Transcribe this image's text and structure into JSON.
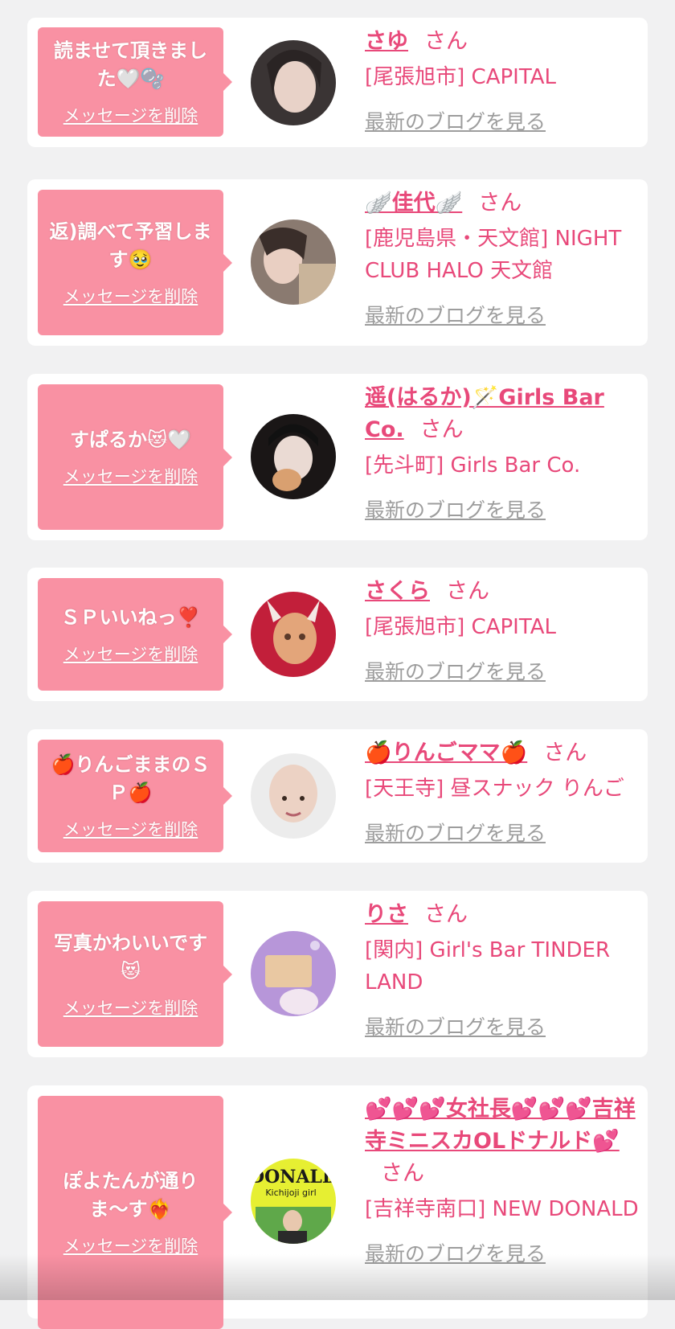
{
  "common": {
    "san": "さん",
    "blog_label": "最新のブログを見る",
    "delete_label": "メッセージを削除"
  },
  "items": [
    {
      "message": "読ませて頂きました🤍🫧",
      "name": "さゆ",
      "shop": "[尾張旭市] CAPITAL"
    },
    {
      "message": "返)調べて予習します🥹",
      "name": "🪽佳代🪽",
      "shop": "[鹿児島県・天文館] NIGHT CLUB HALO 天文館"
    },
    {
      "message": "すぱるか😻🤍",
      "name": "遥(はるか)🪄Girls Bar Co.",
      "shop": "[先斗町] Girls Bar Co."
    },
    {
      "message": "ＳＰいいねっ❣️",
      "name": "さくら",
      "shop": "[尾張旭市] CAPITAL"
    },
    {
      "message": "🍎りんごままのＳＰ🍎",
      "name": "🍎りんごママ🍎",
      "shop": "[天王寺] 昼スナック りんご"
    },
    {
      "message": "写真かわいいです😻",
      "name": "りさ",
      "shop": "[関内] Girl's Bar TINDER LAND"
    },
    {
      "message": "ぽよたんが通りま〜す❤️‍🔥",
      "name": "💕💕💕女社長💕💕💕吉祥寺ミニスカOLドナルド💕",
      "shop": "[吉祥寺南口] NEW DONALD",
      "avatar_text_top": "DONALD",
      "avatar_text_sub": "Kichijoji girl"
    }
  ],
  "colors": {
    "pink_bubble": "#f991a3",
    "accent": "#e8497a",
    "link_gray": "#9d9d9d"
  }
}
